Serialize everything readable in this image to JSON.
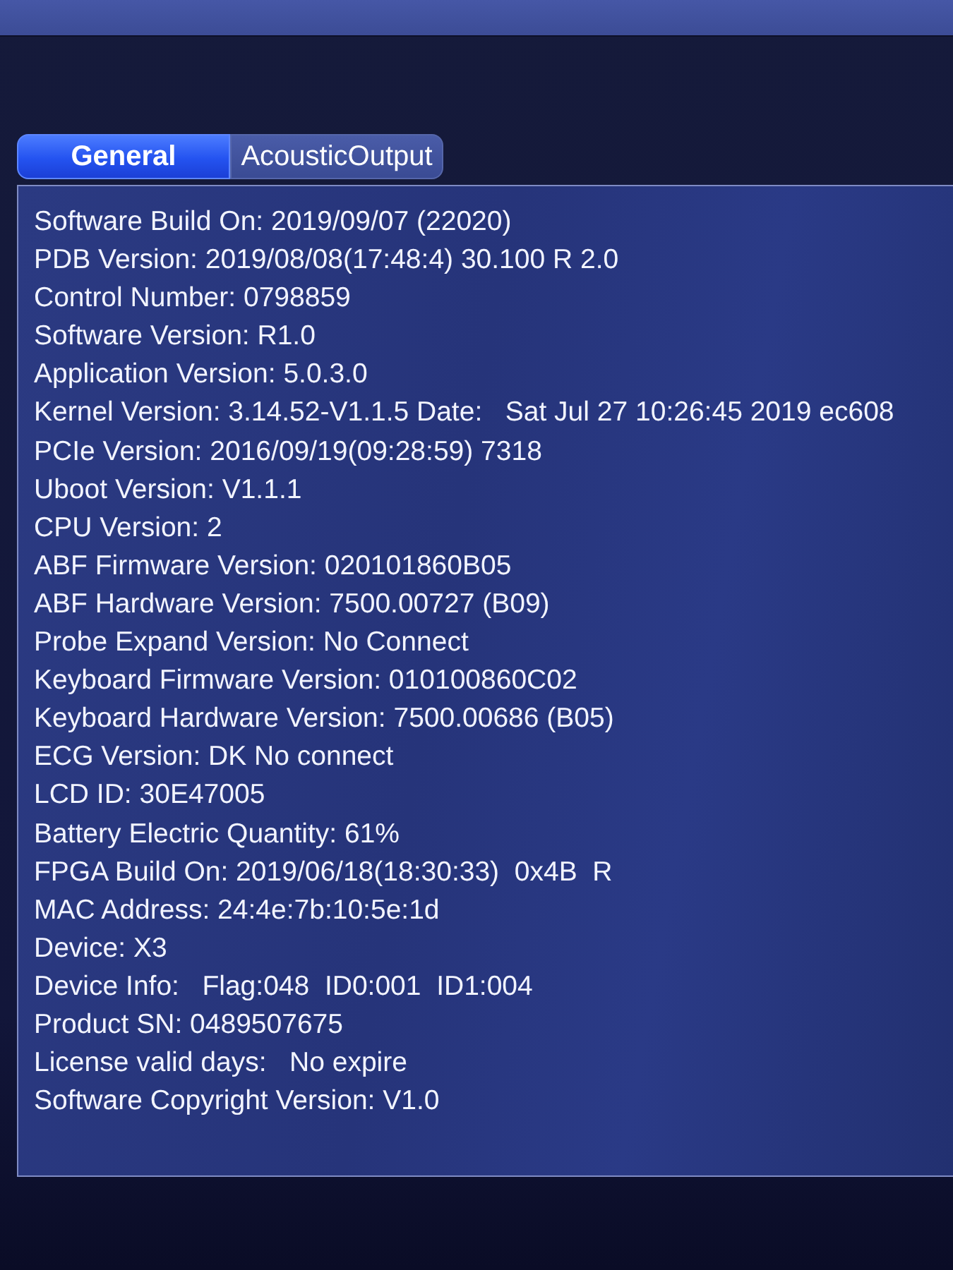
{
  "tabs": [
    {
      "label": "General",
      "selected": true
    },
    {
      "label": "AcousticOutput",
      "selected": false
    }
  ],
  "info_lines": [
    "Software Build On: 2019/09/07 (22020)",
    "PDB Version: 2019/08/08(17:48:4) 30.100 R 2.0",
    "Control Number: 0798859",
    "Software Version: R1.0",
    "Application Version: 5.0.3.0",
    "Kernel Version: 3.14.52-V1.1.5 Date:   Sat Jul 27 10:26:45 2019 ec608",
    "PCIe Version: 2016/09/19(09:28:59) 7318",
    "Uboot Version: V1.1.1",
    "CPU Version: 2",
    "ABF Firmware Version: 020101860B05",
    "ABF Hardware Version: 7500.00727 (B09)",
    "Probe Expand Version: No Connect",
    "Keyboard Firmware Version: 010100860C02",
    "Keyboard Hardware Version: 7500.00686 (B05)",
    "ECG Version: DK No connect",
    "LCD ID: 30E47005",
    "Battery Electric Quantity: 61%",
    "FPGA Build On: 2019/06/18(18:30:33)  0x4B  R",
    "MAC Address: 24:4e:7b:10:5e:1d",
    "Device: X3",
    "Device Info:   Flag:048  ID0:001  ID1:004",
    "Product SN: 0489507675",
    "License valid days:   No expire",
    "Software Copyright Version: V1.0"
  ]
}
